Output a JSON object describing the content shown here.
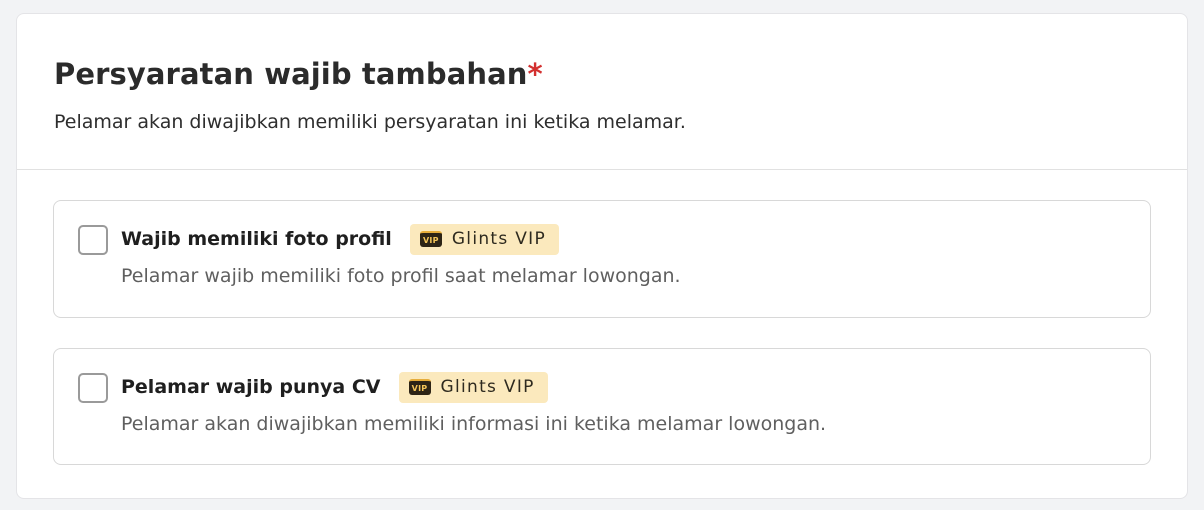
{
  "section": {
    "title": "Persyaratan wajib tambahan",
    "required_marker": "*",
    "subtitle": "Pelamar akan diwajibkan memiliki persyaratan ini ketika melamar."
  },
  "options": [
    {
      "label": "Wajib memiliki foto profil",
      "badge": "Glints VIP",
      "badge_icon": "vip-icon",
      "badge_icon_text": "VIP",
      "description": "Pelamar wajib memiliki foto profil saat melamar lowongan.",
      "checked": false
    },
    {
      "label": "Pelamar wajib punya CV",
      "badge": "Glints VIP",
      "badge_icon": "vip-icon",
      "badge_icon_text": "VIP",
      "description": "Pelamar akan diwajibkan memiliki informasi ini ketika melamar lowongan.",
      "checked": false
    }
  ],
  "colors": {
    "required": "#d3302f",
    "badge_background": "#fbe9bd",
    "badge_icon_background": "#2d2416",
    "badge_icon_accent": "#f4c55a",
    "checkbox_border": "#9a9a9a"
  }
}
